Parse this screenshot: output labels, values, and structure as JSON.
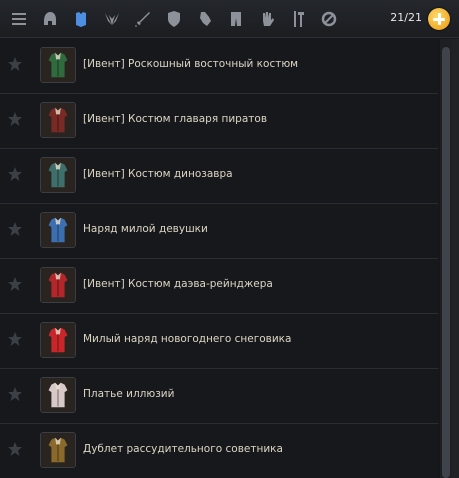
{
  "toolbar": {
    "buttons": [
      {
        "icon": "list-icon"
      },
      {
        "icon": "helmet-icon"
      },
      {
        "icon": "armor-icon"
      },
      {
        "icon": "wings-icon"
      },
      {
        "icon": "sword-icon"
      },
      {
        "icon": "shield-icon"
      },
      {
        "icon": "gauntlet-icon"
      },
      {
        "icon": "pants-icon"
      },
      {
        "icon": "glove-icon"
      },
      {
        "icon": "tools-icon"
      },
      {
        "icon": "ring-icon"
      }
    ],
    "counter": "21/21"
  },
  "items": [
    {
      "name": "[Ивент] Роскошный восточный костюм",
      "icon": "oriental-costume-icon",
      "color": "#2f6b3d"
    },
    {
      "name": "[Ивент] Костюм главаря пиратов",
      "icon": "pirate-costume-icon",
      "color": "#7a2a24"
    },
    {
      "name": "[Ивент] Костюм динозавра",
      "icon": "dinosaur-costume-icon",
      "color": "#3e6f6a"
    },
    {
      "name": "Наряд милой девушки",
      "icon": "cute-girl-outfit-icon",
      "color": "#3b6fb0"
    },
    {
      "name": "[Ивент] Костюм даэва-рейнджера",
      "icon": "ranger-costume-icon",
      "color": "#b3262a"
    },
    {
      "name": "Милый наряд новогоднего снеговика",
      "icon": "snowman-outfit-icon",
      "color": "#c8262a"
    },
    {
      "name": "Платье иллюзий",
      "icon": "illusion-dress-icon",
      "color": "#d8c8c8"
    },
    {
      "name": "Дублет рассудительного советника",
      "icon": "advisor-doublet-icon",
      "color": "#8a6a2a"
    }
  ]
}
